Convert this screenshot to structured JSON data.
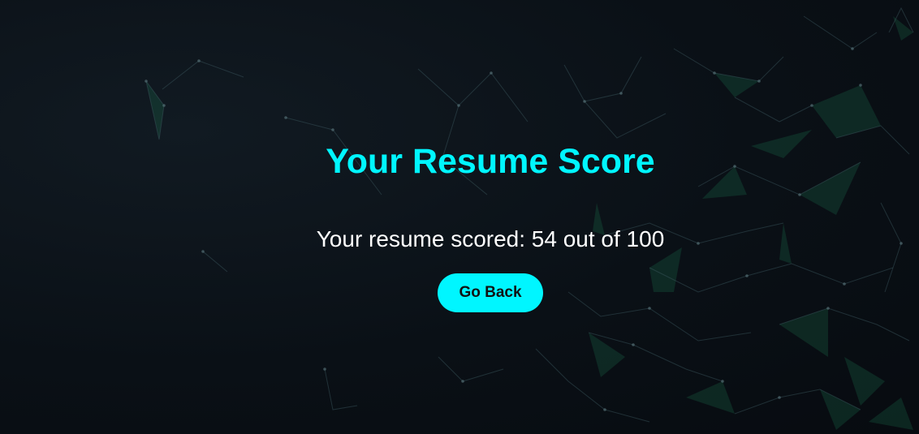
{
  "page": {
    "title": "Your Resume Score",
    "score_text": "Your resume scored: 54 out of 100",
    "go_back_label": "Go Back"
  },
  "colors": {
    "accent": "#00f6ff",
    "background": "#0a1016",
    "network_green": "#1f8a5c"
  }
}
